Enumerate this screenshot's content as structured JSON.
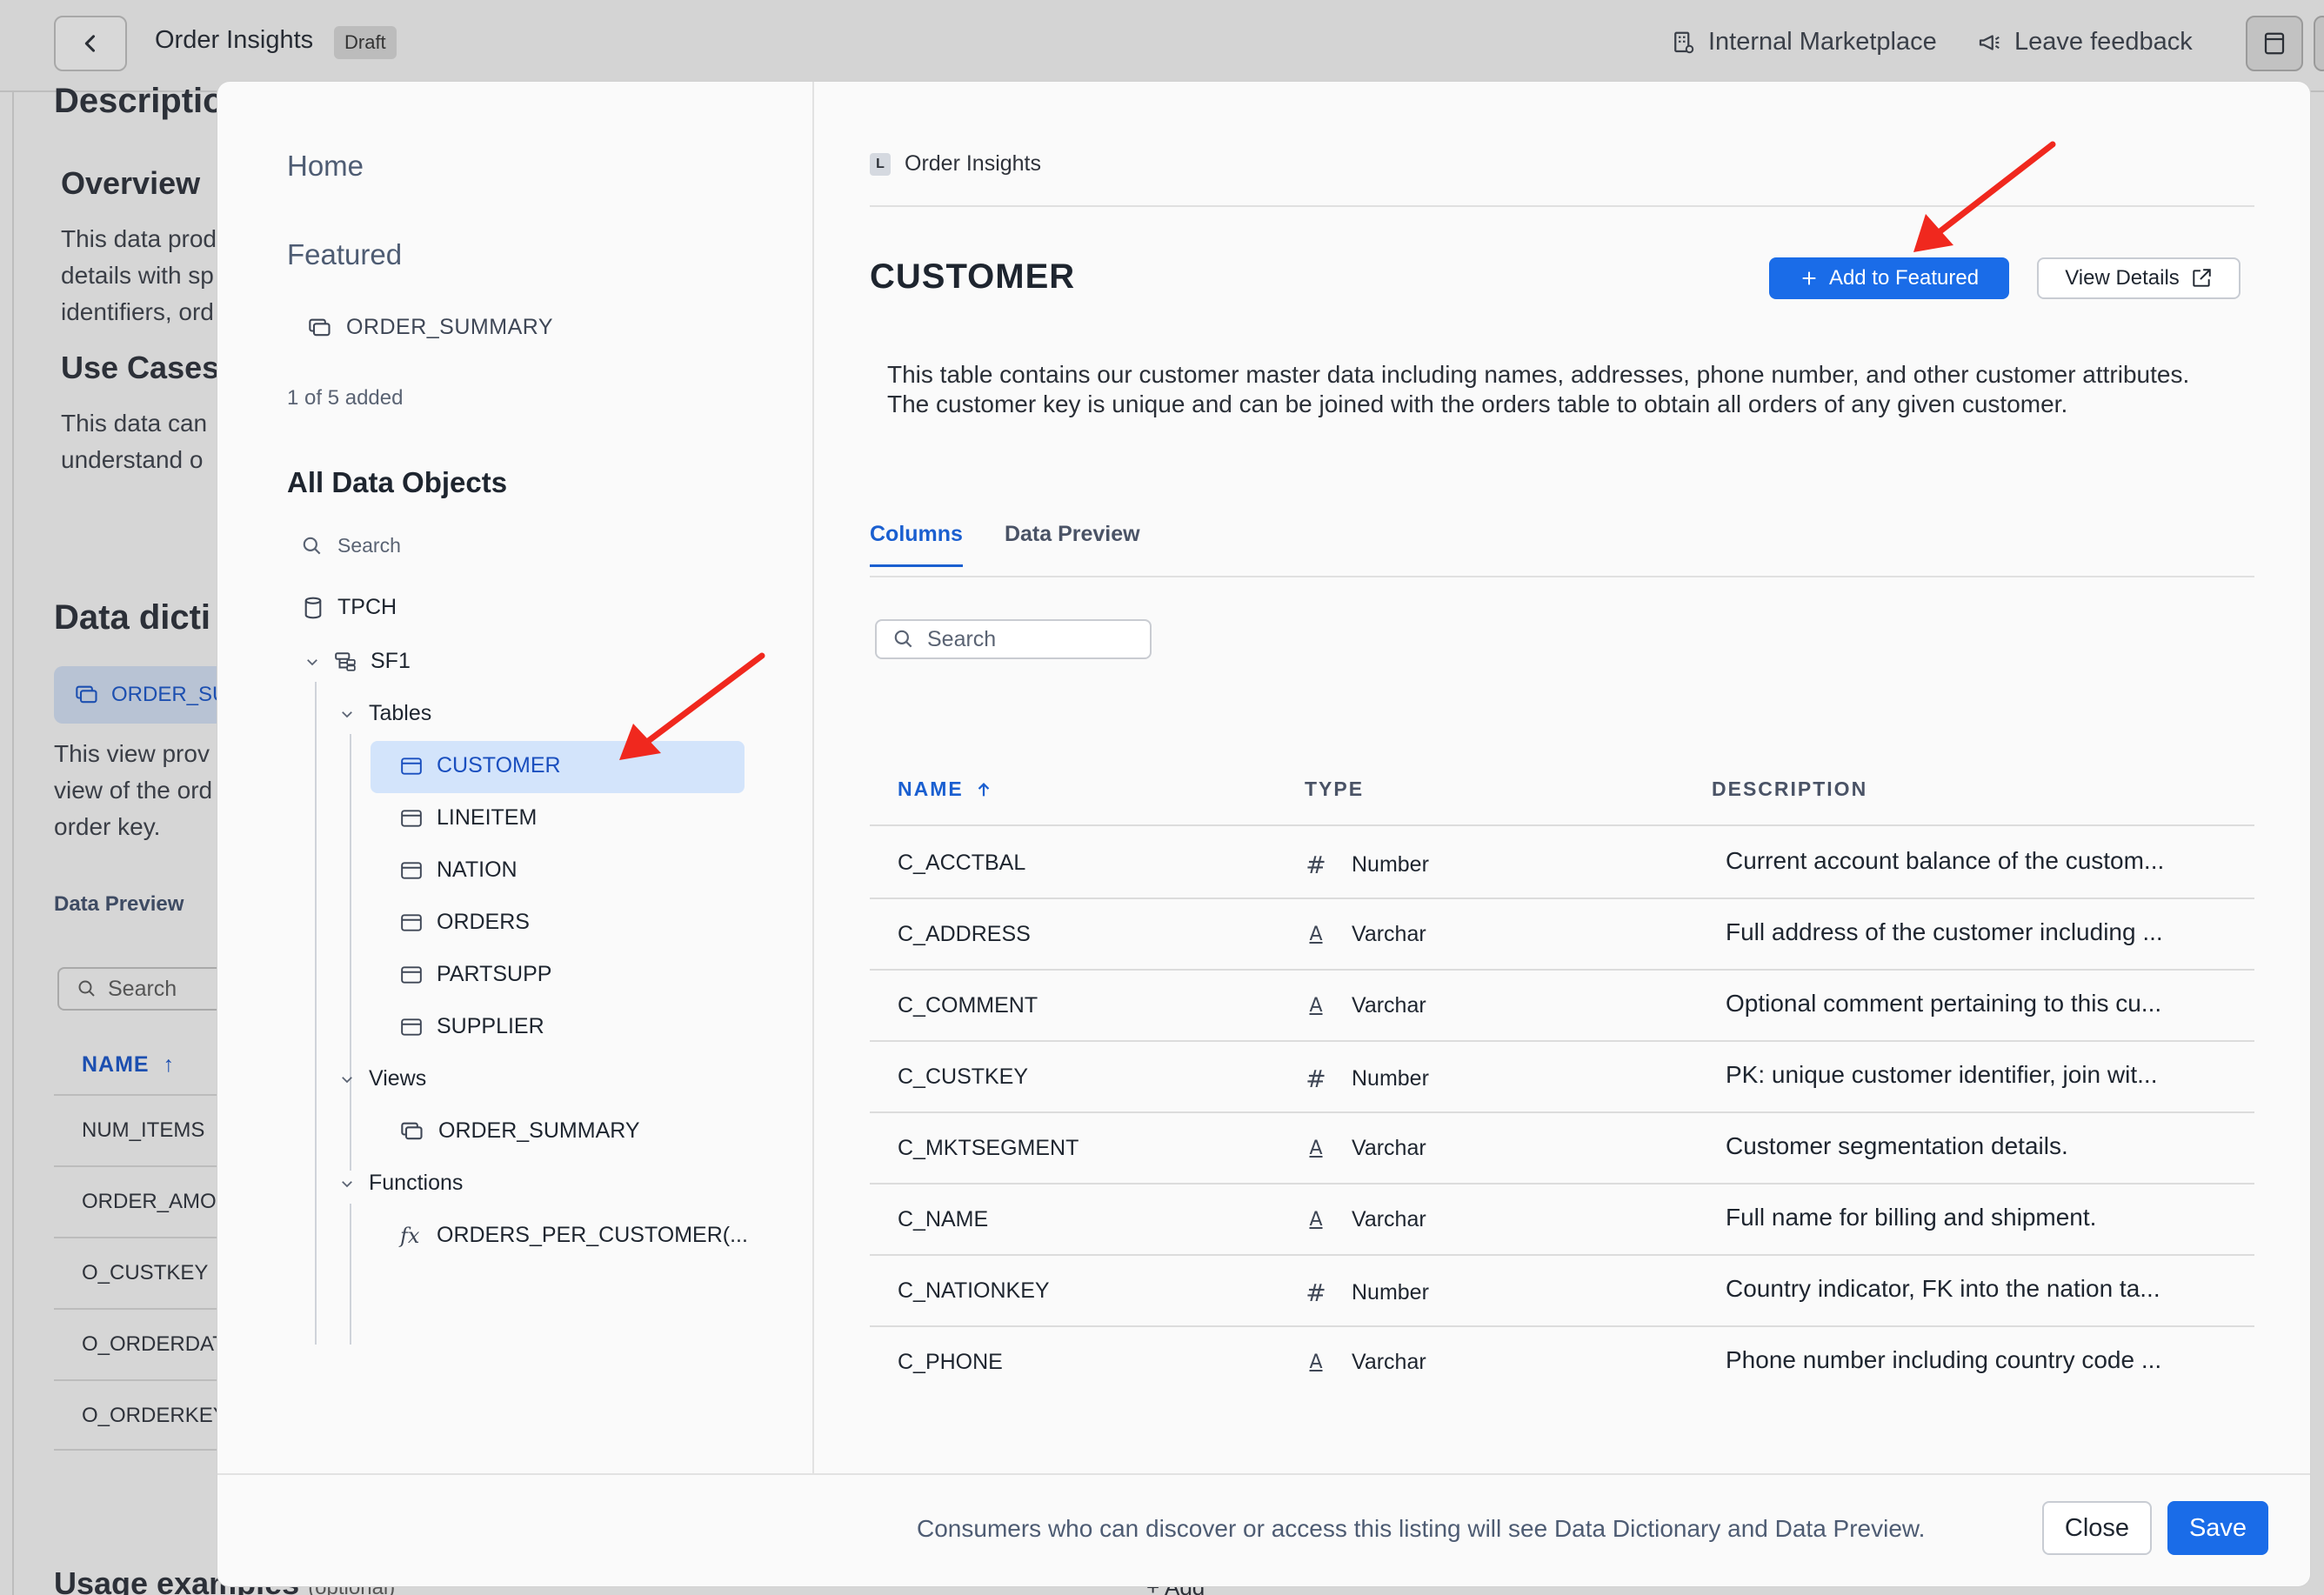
{
  "header": {
    "title": "Order Insights",
    "draft_badge": "Draft",
    "internal_marketplace": "Internal Marketplace",
    "leave_feedback": "Leave feedback"
  },
  "background": {
    "description_heading": "Descriptio",
    "overview": "Overview",
    "overview_lines": [
      "This data prod",
      "details with sp",
      "identifiers, ord"
    ],
    "use_cases": "Use Cases",
    "use_case_lines": [
      "This data can",
      "understand o"
    ],
    "data_dictionary": "Data dicti",
    "chip_label": "ORDER_SU",
    "view_lines": [
      "This view prov",
      "view of the ord",
      "order key."
    ],
    "data_preview": "Data Preview",
    "search_placeholder": "Search",
    "name_header": "NAME",
    "rows": [
      "NUM_ITEMS",
      "ORDER_AMOU",
      "O_CUSTKEY",
      "O_ORDERDAT",
      "O_ORDERKEY"
    ],
    "usage_examples": "Usage examples",
    "optional": "(optional)",
    "add": "Add"
  },
  "sidebar": {
    "home": "Home",
    "featured": "Featured",
    "featured_item": "ORDER_SUMMARY",
    "featured_count": "1 of 5 added",
    "all_title": "All Data Objects",
    "search_placeholder": "Search",
    "database": "TPCH",
    "schema": "SF1",
    "tables_label": "Tables",
    "tables": [
      "CUSTOMER",
      "LINEITEM",
      "NATION",
      "ORDERS",
      "PARTSUPP",
      "SUPPLIER"
    ],
    "views_label": "Views",
    "views": [
      "ORDER_SUMMARY"
    ],
    "functions_label": "Functions",
    "functions": [
      "ORDERS_PER_CUSTOMER(..."
    ]
  },
  "content": {
    "breadcrumb_badge": "L",
    "breadcrumb": "Order Insights",
    "title": "CUSTOMER",
    "add_featured": "Add to Featured",
    "view_details": "View Details",
    "description": "This table contains our customer master data including names, addresses, phone number, and other customer attributes. The customer key is unique and can be joined with the orders table to obtain all orders of any given customer.",
    "tabs": [
      "Columns",
      "Data Preview"
    ],
    "search_placeholder": "Search",
    "columns_header": {
      "name": "NAME",
      "type": "TYPE",
      "description": "DESCRIPTION"
    },
    "rows": [
      {
        "name": "C_ACCTBAL",
        "type_icon": "#",
        "type": "Number",
        "description": "Current account balance of the custom..."
      },
      {
        "name": "C_ADDRESS",
        "type_icon": "A",
        "type": "Varchar",
        "description": "Full address of the customer including ..."
      },
      {
        "name": "C_COMMENT",
        "type_icon": "A",
        "type": "Varchar",
        "description": "Optional comment pertaining to this cu..."
      },
      {
        "name": "C_CUSTKEY",
        "type_icon": "#",
        "type": "Number",
        "description": "PK: unique customer identifier, join wit..."
      },
      {
        "name": "C_MKTSEGMENT",
        "type_icon": "A",
        "type": "Varchar",
        "description": "Customer segmentation details."
      },
      {
        "name": "C_NAME",
        "type_icon": "A",
        "type": "Varchar",
        "description": "Full name for billing and shipment."
      },
      {
        "name": "C_NATIONKEY",
        "type_icon": "#",
        "type": "Number",
        "description": "Country indicator, FK into the nation ta..."
      },
      {
        "name": "C_PHONE",
        "type_icon": "A",
        "type": "Varchar",
        "description": "Phone number including country code ..."
      }
    ]
  },
  "footer": {
    "notice": "Consumers who can discover or access this listing will see Data Dictionary and Data Preview.",
    "close": "Close",
    "save": "Save"
  },
  "colors": {
    "accent": "#1a6ce8",
    "selected_bg": "#d3e4fb",
    "annotation_arrow": "#f0281e"
  }
}
